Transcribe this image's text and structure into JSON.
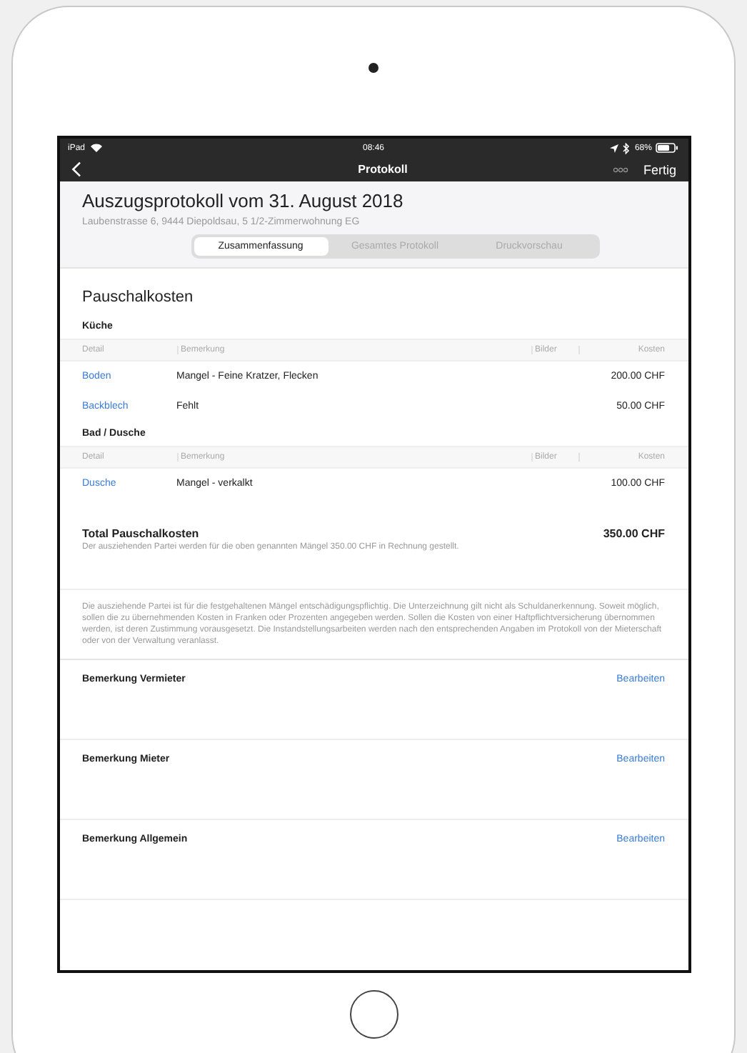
{
  "status_bar": {
    "device": "iPad",
    "time": "08:46",
    "battery": "68%"
  },
  "nav_bar": {
    "title": "Protokoll",
    "done": "Fertig"
  },
  "header": {
    "title": "Auszugsprotokoll vom 31. August 2018",
    "address": "Laubenstrasse 6, 9444 Diepoldsau, 5 1/2-Zimmerwohnung EG",
    "segments": [
      {
        "label": "Zusammenfassung",
        "selected": true
      },
      {
        "label": "Gesamtes Protokoll",
        "selected": false
      },
      {
        "label": "Druckvorschau",
        "selected": false
      }
    ]
  },
  "section": {
    "title": "Pauschalkosten",
    "groups": [
      {
        "name": "Küche",
        "columns": [
          "Detail",
          "Bemerkung",
          "Bilder",
          "Kosten"
        ],
        "rows": [
          {
            "detail": "Boden",
            "remark": "Mangel - Feine Kratzer, Flecken",
            "cost": "200.00 CHF"
          },
          {
            "detail": "Backblech",
            "remark": "Fehlt",
            "cost": "50.00 CHF"
          }
        ]
      },
      {
        "name": "Bad / Dusche",
        "columns": [
          "Detail",
          "Bemerkung",
          "Bilder",
          "Kosten"
        ],
        "rows": [
          {
            "detail": "Dusche",
            "remark": "Mangel - verkalkt",
            "cost": "100.00 CHF"
          }
        ]
      }
    ]
  },
  "total": {
    "label": "Total Pauschalkosten",
    "amount": "350.00 CHF",
    "note": "Der ausziehenden Partei werden für die oben genannten Mängel 350.00 CHF in Rechnung gestellt."
  },
  "disclaimer": "Die ausziehende Partei ist für die festgehaltenen Mängel entschädigungspflichtig. Die Unterzeichnung gilt nicht als Schuldanerkennung. Soweit möglich, sollen die zu übernehmenden Kosten in Franken oder Prozenten angegeben werden. Sollen die Kosten von einer Haftpflichtversicherung übernommen werden, ist deren Zustimmung vorausgesetzt. Die Instandstellungsarbeiten werden nach den entsprechenden Angaben im Protokoll von der Mieterschaft oder von der Verwaltung veranlasst.",
  "remarks": [
    {
      "title": "Bemerkung Vermieter",
      "action": "Bearbeiten"
    },
    {
      "title": "Bemerkung Mieter",
      "action": "Bearbeiten"
    },
    {
      "title": "Bemerkung Allgemein",
      "action": "Bearbeiten"
    }
  ]
}
